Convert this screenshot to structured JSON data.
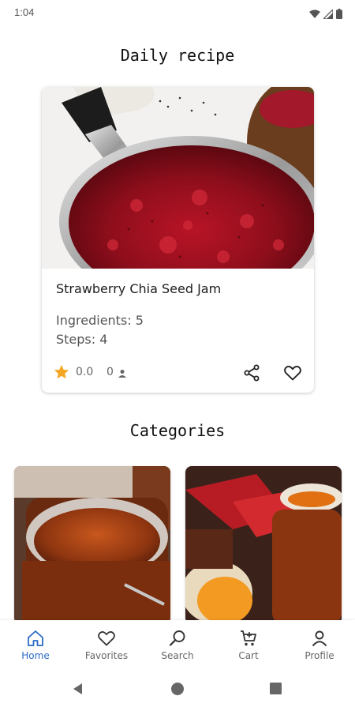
{
  "status_bar": {
    "time": "1:04",
    "icons": [
      "wifi-icon",
      "signal-icon",
      "battery-icon"
    ]
  },
  "daily_recipe": {
    "heading": "Daily recipe",
    "name": "Strawberry Chia Seed Jam",
    "ingredients": "Ingredients: 5",
    "steps": "Steps: 4",
    "rating": "0.0",
    "rating_count": "0",
    "accent_color": "#f5a623"
  },
  "categories": {
    "heading": "Categories",
    "items": [
      {
        "image": "apple-butter-jar-image"
      },
      {
        "image": "jam-jars-with-scones-image"
      }
    ]
  },
  "bottom_nav": {
    "items": [
      {
        "label": "Home",
        "icon": "home-icon",
        "active": true
      },
      {
        "label": "Favorites",
        "icon": "heart-icon",
        "active": false
      },
      {
        "label": "Search",
        "icon": "search-icon",
        "active": false
      },
      {
        "label": "Cart",
        "icon": "cart-icon",
        "active": false
      },
      {
        "label": "Profile",
        "icon": "profile-icon",
        "active": false
      }
    ],
    "active_color": "#2a6bc6"
  },
  "system_nav": {
    "buttons": [
      "back-icon",
      "home-circle-icon",
      "recents-icon"
    ]
  }
}
